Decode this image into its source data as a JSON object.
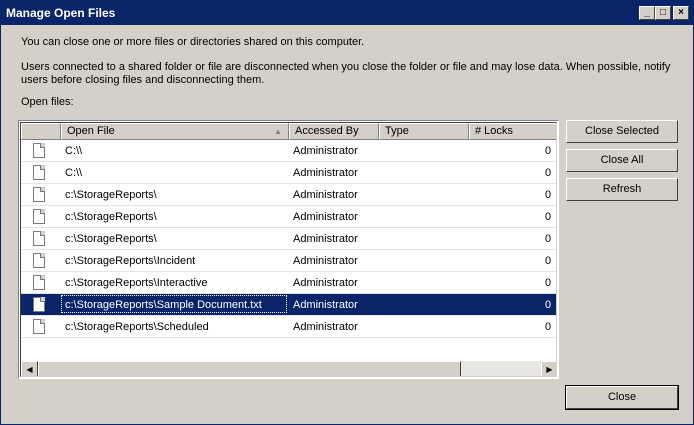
{
  "window": {
    "title": "Manage Open Files",
    "controls": {
      "minimize": "_",
      "maximize": "□",
      "close": "×"
    }
  },
  "description": {
    "line1": "You can close one or more files or directories shared on this computer.",
    "line2": "Users connected to a shared folder or file are disconnected when you close the folder or file and may lose data. When possible, notify",
    "line3": "users before closing files and disconnecting them."
  },
  "open_files_label": "Open files:",
  "columns": {
    "open_file": "Open File",
    "accessed_by": "Accessed By",
    "type": "Type",
    "locks": "# Locks"
  },
  "rows": [
    {
      "file": "C:\\\\",
      "user": "Administrator",
      "type": "",
      "locks": "0"
    },
    {
      "file": "C:\\\\",
      "user": "Administrator",
      "type": "",
      "locks": "0"
    },
    {
      "file": "c:\\StorageReports\\",
      "user": "Administrator",
      "type": "",
      "locks": "0"
    },
    {
      "file": "c:\\StorageReports\\",
      "user": "Administrator",
      "type": "",
      "locks": "0"
    },
    {
      "file": "c:\\StorageReports\\",
      "user": "Administrator",
      "type": "",
      "locks": "0"
    },
    {
      "file": "c:\\StorageReports\\Incident",
      "user": "Administrator",
      "type": "",
      "locks": "0"
    },
    {
      "file": "c:\\StorageReports\\Interactive",
      "user": "Administrator",
      "type": "",
      "locks": "0"
    },
    {
      "file": "c:\\StorageReports\\Sample Document.txt",
      "user": "Administrator",
      "type": "",
      "locks": "0",
      "selected": true
    },
    {
      "file": "c:\\StorageReports\\Scheduled",
      "user": "Administrator",
      "type": "",
      "locks": "0"
    }
  ],
  "buttons": {
    "close_selected": "Close Selected",
    "close_all": "Close All",
    "refresh": "Refresh",
    "close": "Close"
  },
  "colors": {
    "title_bar": "#0a246a",
    "selection": "#0a246a",
    "dialog_bg": "#d4d0c8"
  },
  "icons": {
    "file": "file-icon",
    "sort": "sort-up-icon",
    "scroll_left": "chevron-left-icon",
    "scroll_right": "chevron-right-icon"
  }
}
